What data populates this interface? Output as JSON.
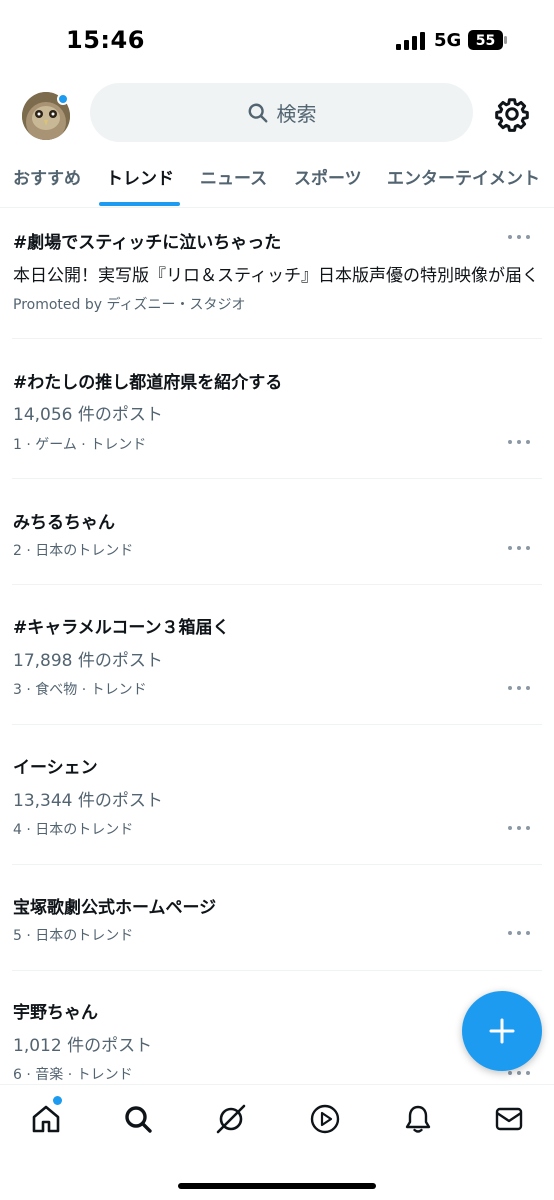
{
  "status_bar": {
    "time": "15:46",
    "network": "5G",
    "battery": "55"
  },
  "header": {
    "search_placeholder": "検索",
    "icons": [
      "avatar",
      "search-icon",
      "gear-icon"
    ]
  },
  "tabs": [
    {
      "label": "おすすめ",
      "active": false
    },
    {
      "label": "トレンド",
      "active": true
    },
    {
      "label": "ニュース",
      "active": false
    },
    {
      "label": "スポーツ",
      "active": false
    },
    {
      "label": "エンターテイメント",
      "active": false
    }
  ],
  "trends": [
    {
      "title": "#劇場でスティッチに泣いちゃった",
      "subtitle": "本日公開！実写版『リロ＆スティッチ』日本版声優の特別映像が届く",
      "meta": "Promoted by ディズニー・スタジオ"
    },
    {
      "title": "#わたしの推し都道府県を紹介する",
      "subtitle": "14,056 件のポスト",
      "meta": "1 · ゲーム · トレンド"
    },
    {
      "title": "みちるちゃん",
      "subtitle": "",
      "meta": "2 · 日本のトレンド"
    },
    {
      "title": "#キャラメルコーン３箱届く",
      "subtitle": "17,898 件のポスト",
      "meta": "3 · 食べ物 · トレンド"
    },
    {
      "title": "イーシェン",
      "subtitle": "13,344 件のポスト",
      "meta": "4 · 日本のトレンド"
    },
    {
      "title": "宝塚歌劇公式ホームページ",
      "subtitle": "",
      "meta": "5 · 日本のトレンド"
    },
    {
      "title": "宇野ちゃん",
      "subtitle": "1,012 件のポスト",
      "meta": "6 · 音楽 · トレンド"
    }
  ],
  "bottom_nav": [
    "home-icon",
    "search-icon",
    "grok-icon",
    "play-icon",
    "bell-icon",
    "mail-icon"
  ],
  "colors": {
    "accent": "#1d9bf0",
    "text_primary": "#0f1419",
    "text_secondary": "#536471"
  }
}
